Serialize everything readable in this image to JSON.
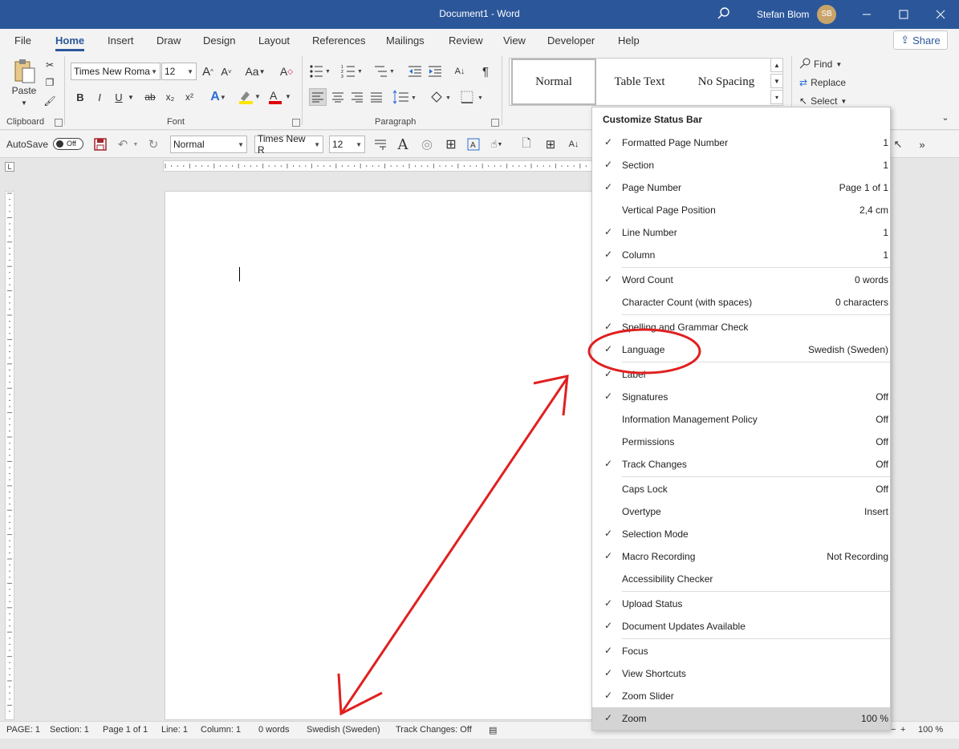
{
  "title_bar": {
    "title": "Document1  -  Word",
    "user_name": "Stefan Blom",
    "user_initials": "SB",
    "color": "#2b579a"
  },
  "tabs": [
    "File",
    "Home",
    "Insert",
    "Draw",
    "Design",
    "Layout",
    "References",
    "Mailings",
    "Review",
    "View",
    "Developer",
    "Help"
  ],
  "active_tab": "Home",
  "share_label": "Share",
  "ribbon": {
    "clipboard": {
      "paste_label": "Paste",
      "group_label": "Clipboard"
    },
    "font": {
      "font_name": "Times New Roma",
      "font_size": "12",
      "group_label": "Font",
      "bold": "B",
      "italic": "I",
      "underline": "U",
      "strikethrough": "ab",
      "subscript": "x₂",
      "superscript": "x²",
      "change_case": "Aa"
    },
    "paragraph": {
      "group_label": "Paragraph",
      "show_marks": "¶"
    },
    "styles": {
      "items": [
        "Normal",
        "Table Text",
        "No Spacing"
      ]
    },
    "editing": {
      "find": "Find",
      "replace": "Replace",
      "select": "Select"
    }
  },
  "qat": {
    "autosave_label": "AutoSave",
    "autosave_state": "Off",
    "style_value": "Normal",
    "font_value": "Times New R",
    "size_value": "12"
  },
  "status_bar": {
    "page": "PAGE: 1",
    "section": "Section: 1",
    "page_of": "Page 1 of 1",
    "line": "Line: 1",
    "column": "Column: 1",
    "words": "0 words",
    "language": "Swedish (Sweden)",
    "track_changes": "Track Changes: Off",
    "focus": "Focus",
    "zoom_minus": "−",
    "zoom_plus": "+",
    "zoom": "100 %"
  },
  "menu": {
    "title": "Customize Status Bar",
    "groups": [
      [
        {
          "label": "Formatted Page Number",
          "value": "1",
          "checked": true
        },
        {
          "label": "Section",
          "value": "1",
          "checked": true
        },
        {
          "label": "Page Number",
          "value": "Page 1 of 1",
          "checked": true
        },
        {
          "label": "Vertical Page Position",
          "value": "2,4 cm",
          "checked": false
        },
        {
          "label": "Line Number",
          "value": "1",
          "checked": true
        },
        {
          "label": "Column",
          "value": "1",
          "checked": true
        }
      ],
      [
        {
          "label": "Word Count",
          "value": "0 words",
          "checked": true
        },
        {
          "label": "Character Count (with spaces)",
          "value": "0 characters",
          "checked": false
        }
      ],
      [
        {
          "label": "Spelling and Grammar Check",
          "value": "",
          "checked": true
        },
        {
          "label": "Language",
          "value": "Swedish (Sweden)",
          "checked": true
        }
      ],
      [
        {
          "label": "Label",
          "value": "",
          "checked": true
        },
        {
          "label": "Signatures",
          "value": "Off",
          "checked": true
        },
        {
          "label": "Information Management Policy",
          "value": "Off",
          "checked": false
        },
        {
          "label": "Permissions",
          "value": "Off",
          "checked": false
        },
        {
          "label": "Track Changes",
          "value": "Off",
          "checked": true
        }
      ],
      [
        {
          "label": "Caps Lock",
          "value": "Off",
          "checked": false
        },
        {
          "label": "Overtype",
          "value": "Insert",
          "checked": false
        },
        {
          "label": "Selection Mode",
          "value": "",
          "checked": true
        },
        {
          "label": "Macro Recording",
          "value": "Not Recording",
          "checked": true
        },
        {
          "label": "Accessibility Checker",
          "value": "",
          "checked": false
        }
      ],
      [
        {
          "label": "Upload Status",
          "value": "",
          "checked": true
        },
        {
          "label": "Document Updates Available",
          "value": "",
          "checked": true
        }
      ],
      [
        {
          "label": "Focus",
          "value": "",
          "checked": true
        },
        {
          "label": "View Shortcuts",
          "value": "",
          "checked": true
        },
        {
          "label": "Zoom Slider",
          "value": "",
          "checked": true
        },
        {
          "label": "Zoom",
          "value": "100 %",
          "checked": true,
          "highlighted": true
        }
      ]
    ]
  },
  "annotation": {
    "color": "#e02020"
  }
}
